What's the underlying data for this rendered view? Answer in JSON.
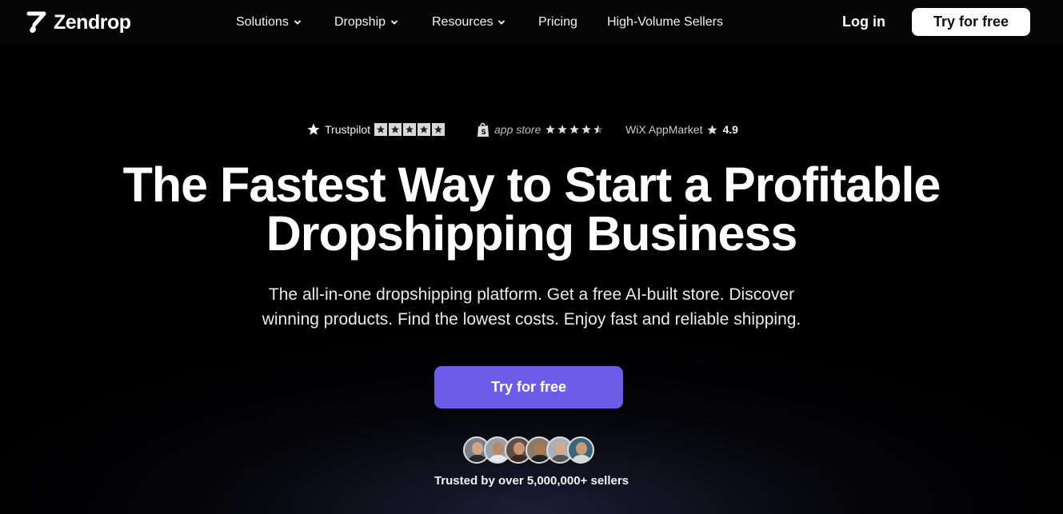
{
  "brand": {
    "name": "Zendrop"
  },
  "nav": {
    "items": [
      {
        "label": "Solutions",
        "has_dropdown": true
      },
      {
        "label": "Dropship",
        "has_dropdown": true
      },
      {
        "label": "Resources",
        "has_dropdown": true
      },
      {
        "label": "Pricing",
        "has_dropdown": false
      },
      {
        "label": "High-Volume Sellers",
        "has_dropdown": false
      }
    ],
    "login_label": "Log in",
    "cta_label": "Try for free"
  },
  "ratings": {
    "trustpilot": {
      "label": "Trustpilot",
      "stars": 5
    },
    "appstore": {
      "label": "app store",
      "stars": 4.5
    },
    "wix": {
      "label": "WiX AppMarket",
      "score": "4.9"
    }
  },
  "hero": {
    "headline_line1": "The Fastest Way to Start a Profitable",
    "headline_line2": "Dropshipping Business",
    "sub_line1": "The all-in-one dropshipping platform. Get a free AI-built store. Discover",
    "sub_line2": "winning products. Find the lowest costs. Enjoy fast and reliable shipping.",
    "cta_label": "Try for free",
    "trusted_text": "Trusted by over 5,000,000+ sellers"
  },
  "colors": {
    "accent": "#6c5ce7",
    "background": "#000000",
    "nav_cta_bg": "#ffffff"
  }
}
